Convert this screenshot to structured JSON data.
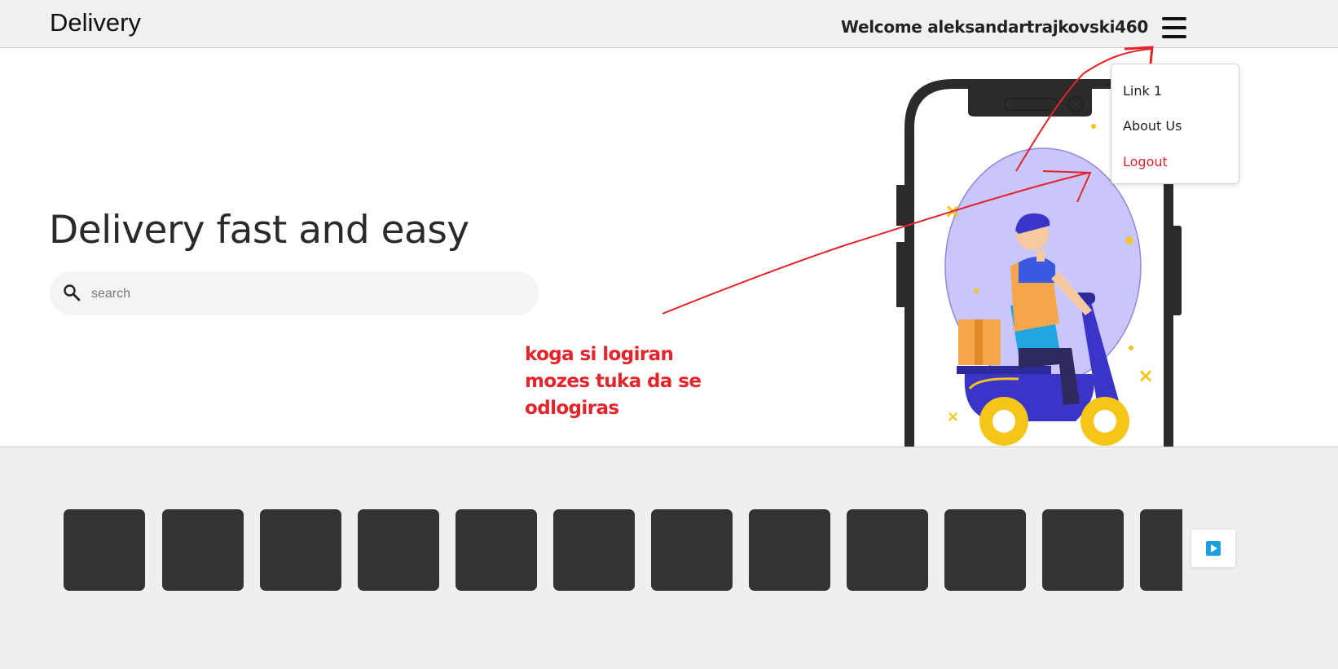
{
  "header": {
    "brand": "Delivery",
    "welcome_text": "Welcome aleksandartrajkovski460"
  },
  "menu": {
    "items": [
      {
        "label": "Link 1"
      },
      {
        "label": "About Us"
      },
      {
        "label": "Logout",
        "color": "#e3242b"
      }
    ]
  },
  "hero": {
    "title": "Delivery fast and easy",
    "search": {
      "placeholder": "search",
      "value": ""
    },
    "illustration": "delivery-scooter-phone-illustration"
  },
  "annotation": {
    "lines": [
      "koga si logiran",
      "mozes tuka da se",
      "odlogiras"
    ],
    "color": "#e3242b"
  },
  "carousel": {
    "card_count": 12,
    "card_color": "#333333",
    "next_icon": "play-icon",
    "next_icon_color": "#1a9fe0"
  }
}
